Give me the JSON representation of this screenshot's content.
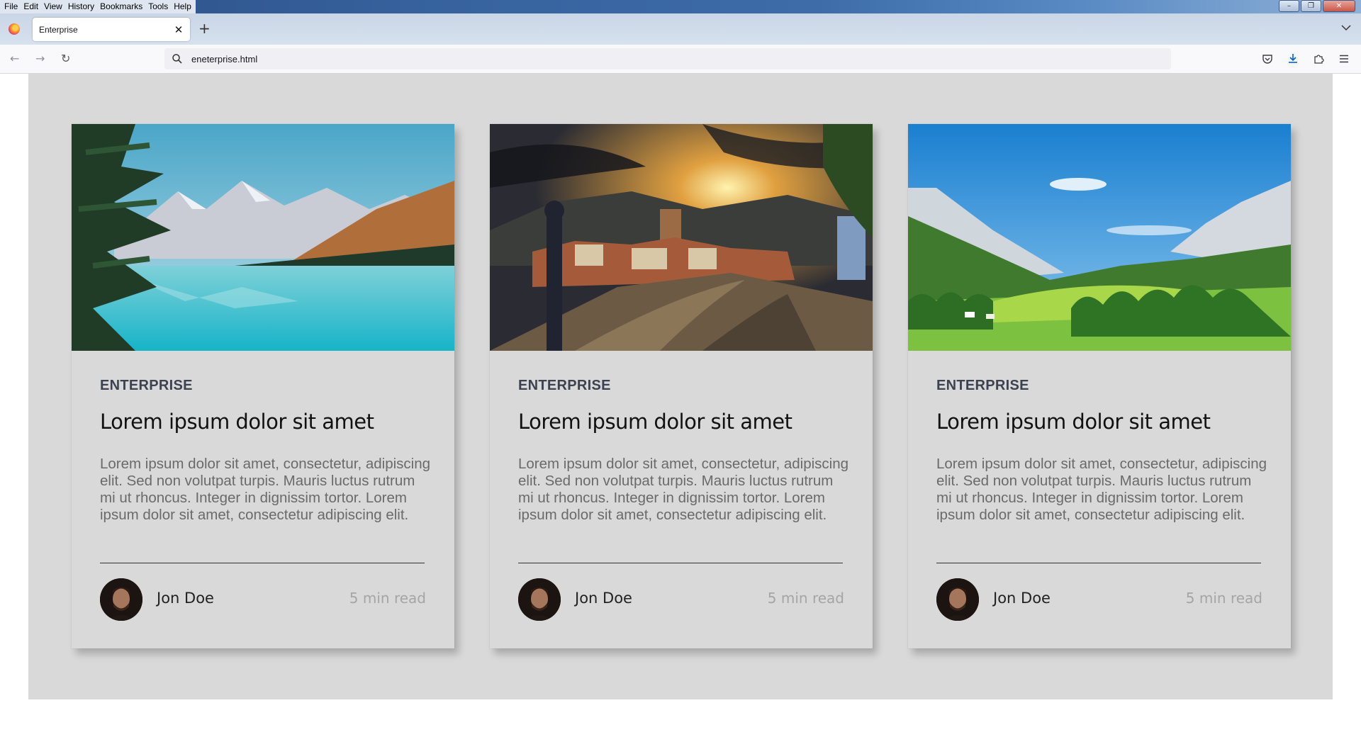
{
  "menu": [
    "File",
    "Edit",
    "View",
    "History",
    "Bookmarks",
    "Tools",
    "Help"
  ],
  "window_controls": {
    "minimize": "–",
    "restore": "❐",
    "close": "✕"
  },
  "tab": {
    "title": "Enterprise",
    "close": "✕",
    "new_tab": "+"
  },
  "nav": {
    "back": "←",
    "forward": "→",
    "reload": "↻"
  },
  "url": "eneterprise.html",
  "cards": [
    {
      "category": "ENTERPRISE",
      "title": "Lorem ipsum dolor sit amet",
      "text": "Lorem ipsum dolor sit amet, consectetur, adipiscing elit. Sed non volutpat turpis. Mauris luctus rutrum mi ut rhoncus. Integer in dignissim tortor. Lorem ipsum dolor sit amet, consectetur adipiscing elit.",
      "author": "Jon Doe",
      "read_time": "5 min read",
      "image": "mountain-lake"
    },
    {
      "category": "ENTERPRISE",
      "title": "Lorem ipsum dolor sit amet",
      "text": "Lorem ipsum dolor sit amet, consectetur, adipiscing elit. Sed non volutpat turpis. Mauris luctus rutrum mi ut rhoncus. Integer in dignissim tortor. Lorem ipsum dolor sit amet, consectetur adipiscing elit.",
      "author": "Jon Doe",
      "read_time": "5 min read",
      "image": "old-town-street"
    },
    {
      "category": "ENTERPRISE",
      "title": "Lorem ipsum dolor sit amet",
      "text": "Lorem ipsum dolor sit amet, consectetur, adipiscing elit. Sed non volutpat turpis. Mauris luctus rutrum mi ut rhoncus. Integer in dignissim tortor. Lorem ipsum dolor sit amet, consectetur adipiscing elit.",
      "author": "Jon Doe",
      "read_time": "5 min read",
      "image": "green-valley"
    }
  ],
  "colors": {
    "page_bg": "#d9d9d9",
    "category": "#3c4250",
    "body_text": "#6a6a6a",
    "muted": "#a5a5a5"
  }
}
